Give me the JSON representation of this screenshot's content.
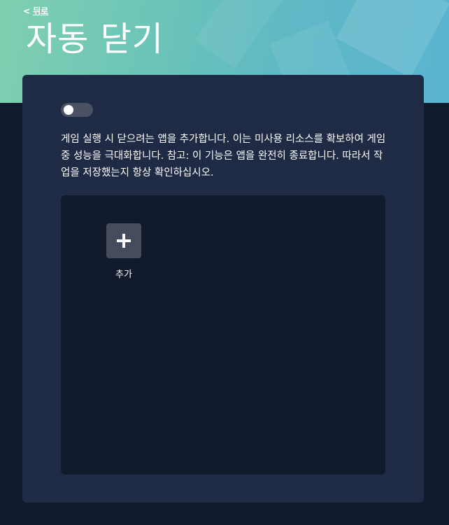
{
  "header": {
    "back_chevron": "<",
    "back_label": "뒤로",
    "title": "자동 닫기"
  },
  "settings": {
    "auto_close_enabled": false,
    "description": "게임 실행 시 닫으려는 앱을 추가합니다. 이는 미사용 리소스를 확보하여 게임 중 성능을 극대화합니다. 참고: 이 기능은 앱을 완전히 종료합니다. 따라서 작업을 저장했는지 항상 확인하십시오."
  },
  "apps": {
    "add_label": "추가",
    "add_icon": "plus-icon"
  },
  "colors": {
    "hero_gradient_start": "#7fcfb0",
    "hero_gradient_end": "#5ab4d0",
    "page_background": "#111a2c",
    "panel_background": "#1f2a44",
    "tile_background": "#464c5c",
    "toggle_track_off": "#4b5263"
  }
}
